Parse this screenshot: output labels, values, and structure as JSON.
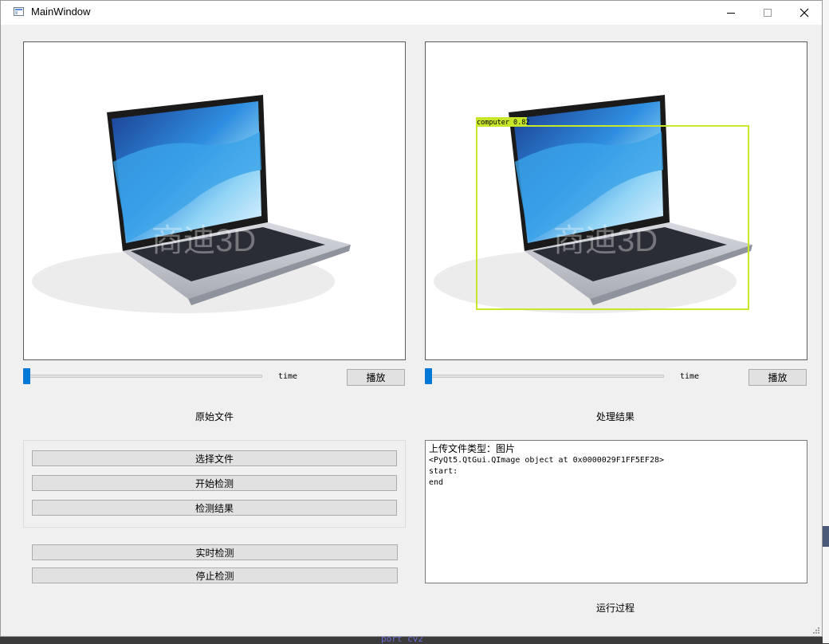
{
  "window": {
    "title": "MainWindow"
  },
  "left_panel": {
    "caption": "原始文件",
    "slider": {
      "label": "time",
      "position": 0
    },
    "play_label": "播放"
  },
  "right_panel": {
    "caption": "处理结果",
    "slider": {
      "label": "time",
      "position": 0
    },
    "play_label": "播放",
    "detection": {
      "label": "computer 0.82",
      "box_color": "#c8e62a"
    }
  },
  "controls": {
    "select_file": "选择文件",
    "start_detect": "开始检测",
    "detect_result": "检测结果",
    "realtime_detect": "实时检测",
    "stop_detect": "停止检测"
  },
  "log": {
    "lines": [
      "上传文件类型：图片",
      "<PyQt5.QtGui.QImage object at 0x0000029F1FF5EF28>",
      "start:",
      "end"
    ],
    "caption": "运行过程"
  },
  "background": {
    "code_fragment": "port cv2"
  },
  "colors": {
    "accent": "#0078d7",
    "window_bg": "#f0f0f0",
    "detection_box": "#c8e62a"
  },
  "icons": [
    "app-window-icon",
    "minimize-icon",
    "maximize-icon",
    "close-icon",
    "resize-grip-icon"
  ]
}
